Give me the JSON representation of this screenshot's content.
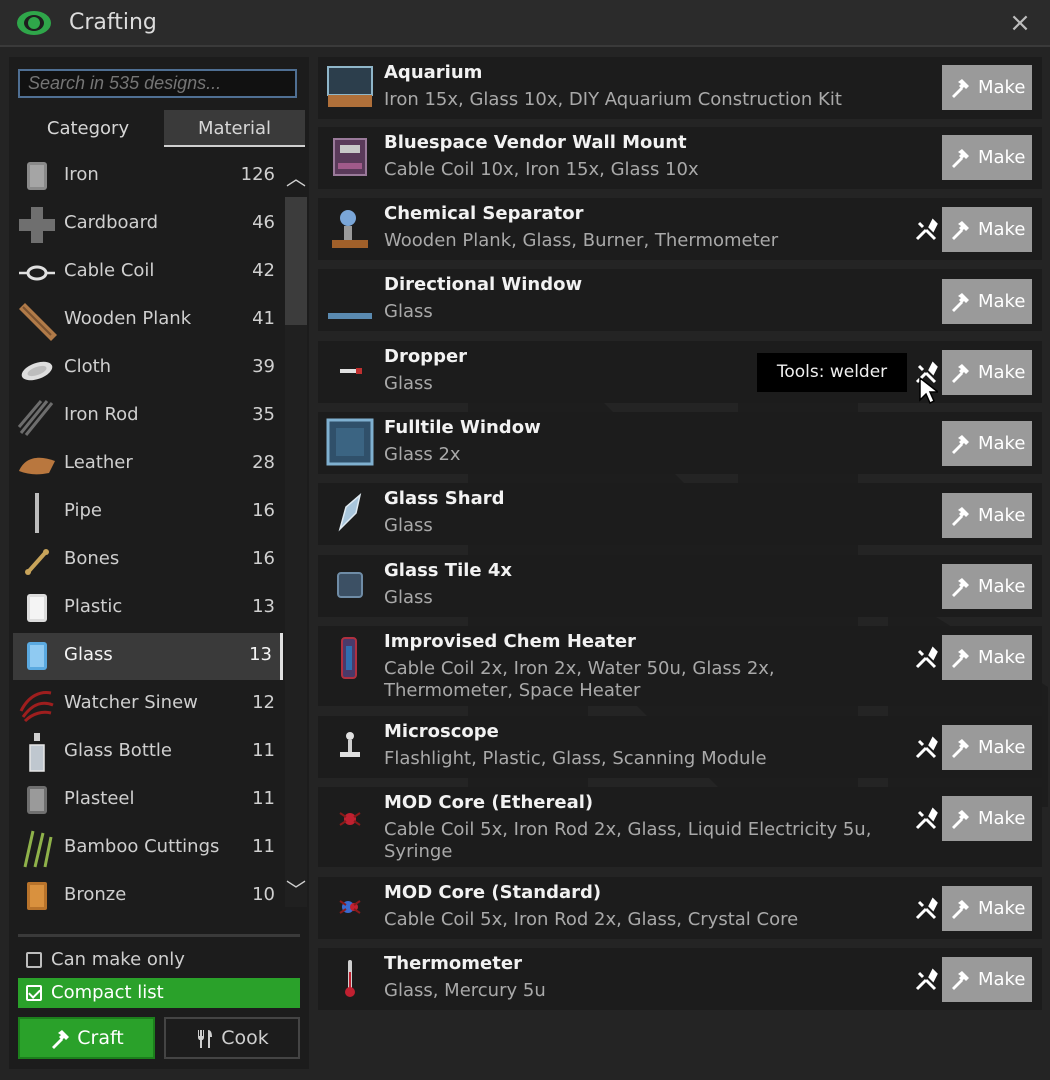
{
  "window": {
    "title": "Crafting",
    "close": "×",
    "logo_icon": "eye-icon"
  },
  "search": {
    "placeholder": "Search in 535 designs..."
  },
  "tabs": {
    "category": "Category",
    "material": "Material"
  },
  "materials": [
    {
      "name": "Iron",
      "count": "126"
    },
    {
      "name": "Cardboard",
      "count": "46"
    },
    {
      "name": "Cable Coil",
      "count": "42"
    },
    {
      "name": "Wooden Plank",
      "count": "41"
    },
    {
      "name": "Cloth",
      "count": "39"
    },
    {
      "name": "Iron Rod",
      "count": "35"
    },
    {
      "name": "Leather",
      "count": "28"
    },
    {
      "name": "Pipe",
      "count": "16"
    },
    {
      "name": "Bones",
      "count": "16"
    },
    {
      "name": "Plastic",
      "count": "13"
    },
    {
      "name": "Glass",
      "count": "13",
      "selected": true
    },
    {
      "name": "Watcher Sinew",
      "count": "12"
    },
    {
      "name": "Glass Bottle",
      "count": "11"
    },
    {
      "name": "Plasteel",
      "count": "11"
    },
    {
      "name": "Bamboo Cuttings",
      "count": "11"
    },
    {
      "name": "Bronze",
      "count": "10"
    }
  ],
  "filters": {
    "can_make_only": "Can make only",
    "compact_list": "Compact list"
  },
  "buttons": {
    "craft": "Craft",
    "cook": "Cook"
  },
  "make_label": "Make",
  "recipes": [
    {
      "name": "Aquarium",
      "materials": "Iron 15x, Glass 10x, DIY Aquarium Construction Kit",
      "tools": false
    },
    {
      "name": "Bluespace Vendor Wall Mount",
      "materials": "Cable Coil 10x, Iron 15x, Glass 10x",
      "tools": false
    },
    {
      "name": "Chemical Separator",
      "materials": "Wooden Plank, Glass, Burner, Thermometer",
      "tools": true
    },
    {
      "name": "Directional Window",
      "materials": "Glass",
      "tools": false
    },
    {
      "name": "Dropper",
      "materials": "Glass",
      "tools": true
    },
    {
      "name": "Fulltile Window",
      "materials": "Glass 2x",
      "tools": false
    },
    {
      "name": "Glass Shard",
      "materials": "Glass",
      "tools": false
    },
    {
      "name": "Glass Tile 4x",
      "materials": "Glass",
      "tools": false
    },
    {
      "name": "Improvised Chem Heater",
      "materials": "Cable Coil 2x, Iron 2x, Water 50u, Glass 2x, Thermometer, Space Heater",
      "tools": true
    },
    {
      "name": "Microscope",
      "materials": "Flashlight, Plastic, Glass, Scanning Module",
      "tools": true
    },
    {
      "name": "MOD Core (Ethereal)",
      "materials": "Cable Coil 5x, Iron Rod 2x, Glass, Liquid Electricity 5u, Syringe",
      "tools": true
    },
    {
      "name": "MOD Core (Standard)",
      "materials": "Cable Coil 5x, Iron Rod 2x, Glass, Crystal Core",
      "tools": true
    },
    {
      "name": "Thermometer",
      "materials": "Glass, Mercury 5u",
      "tools": true
    }
  ],
  "tooltip": "Tools: welder",
  "colors": {
    "accent_green": "#2aa12a",
    "search_border": "#4f6f93",
    "make_button": "#9a9a9a"
  }
}
